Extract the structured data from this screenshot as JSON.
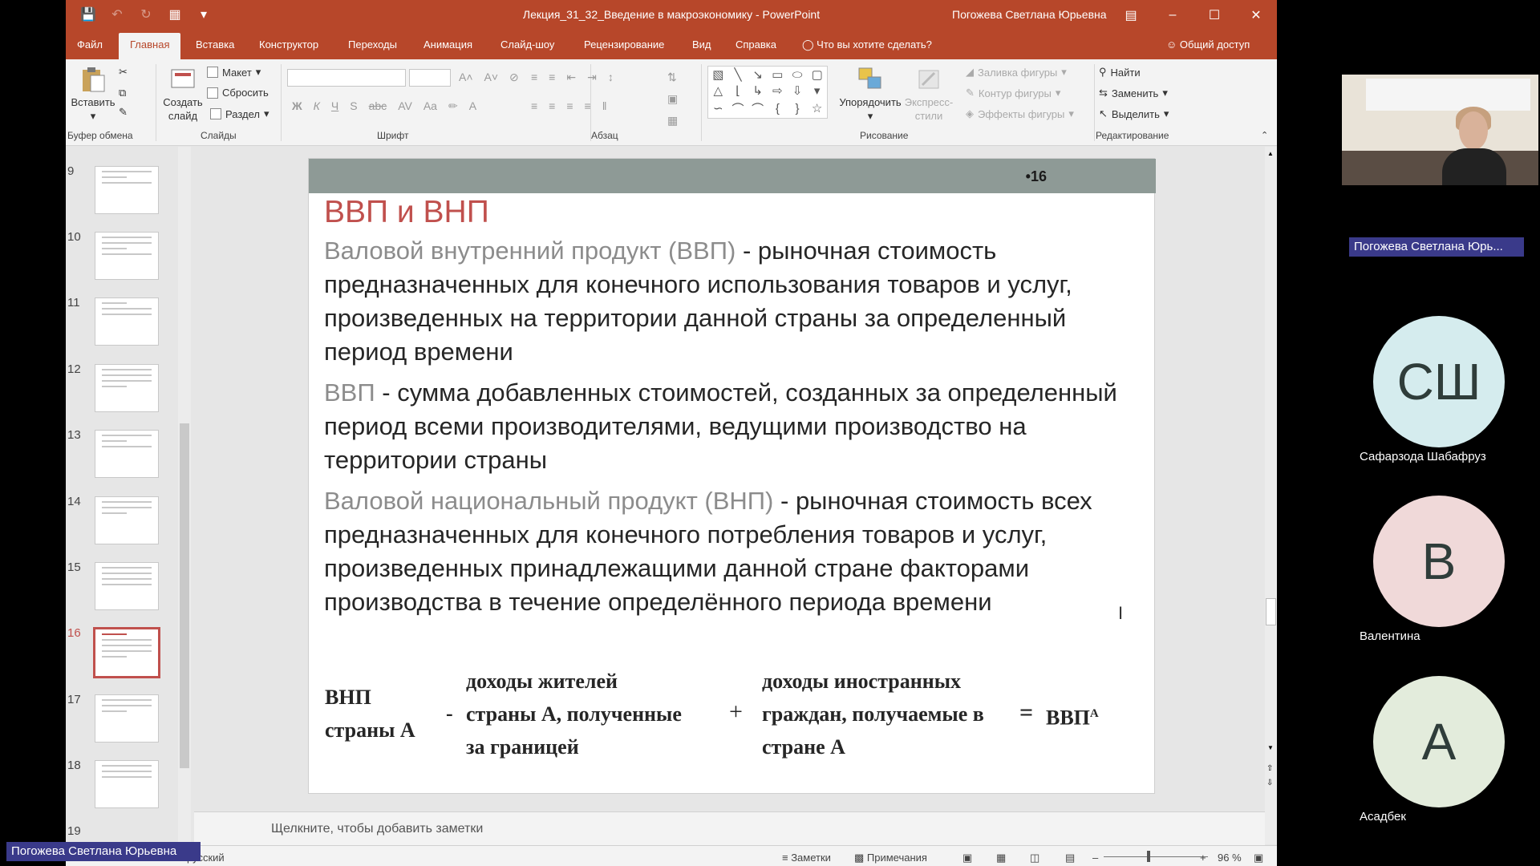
{
  "app": {
    "doc_title": "Лекция_31_32_Введение в макроэкономику  -  PowerPoint",
    "user_name": "Погожева Светлана Юрьевна"
  },
  "tabs": [
    "Файл",
    "Главная",
    "Вставка",
    "Конструктор",
    "Переходы",
    "Анимация",
    "Слайд-шоу",
    "Рецензирование",
    "Вид",
    "Справка"
  ],
  "tell_me": "Что вы хотите сделать?",
  "share": "Общий доступ",
  "ribbon": {
    "paste": "Вставить",
    "new_slide_1": "Создать",
    "new_slide_2": "слайд",
    "layout": "Макет",
    "reset": "Сбросить",
    "section": "Раздел",
    "arrange": "Упорядочить",
    "express_1": "Экспресс-",
    "express_2": "стили",
    "shape_fill": "Заливка фигуры",
    "shape_outline": "Контур фигуры",
    "shape_effects": "Эффекты фигуры",
    "find": "Найти",
    "replace": "Заменить",
    "select": "Выделить",
    "groups": {
      "clipboard": "Буфер обмена",
      "slides": "Слайды",
      "font": "Шрифт",
      "paragraph": "Абзац",
      "drawing": "Рисование",
      "editing": "Редактирование"
    }
  },
  "thumbnails": [
    {
      "num": "9"
    },
    {
      "num": "10"
    },
    {
      "num": "11"
    },
    {
      "num": "12"
    },
    {
      "num": "13"
    },
    {
      "num": "14"
    },
    {
      "num": "15"
    },
    {
      "num": "16"
    },
    {
      "num": "17"
    },
    {
      "num": "18"
    },
    {
      "num": "19"
    }
  ],
  "slide": {
    "number": "•16",
    "title": "ВВП и ВНП",
    "p1_term": "Валовой внутренний продукт (ВВП)",
    "p1_text": " - рыночная стоимость предназначенных для конечного использования товаров и услуг, произведенных на территории данной страны за определенный период времени",
    "p2_term": "ВВП",
    "p2_text": " - сумма добавленных стоимостей, созданных за определенный период всеми производителями, ведущими производство на территории страны",
    "p3_term": "Валовой национальный продукт (ВНП)",
    "p3_text": " - рыночная стоимость всех предназначенных для конечного потребления товаров и услуг, произведенных принадлежащими данной стране факторами производства в течение определённого периода времени",
    "formula": {
      "left_1": "ВНП",
      "left_2": "страны А",
      "minus": "-",
      "mid_1": "доходы жителей",
      "mid_2": "страны А, полученные",
      "mid_3": "за границей",
      "plus": "+",
      "right_1": "доходы иностранных",
      "right_2": "граждан, получаемые в",
      "right_3": "стране А",
      "equals": "=",
      "result": "ВВП",
      "result_sup": "А"
    }
  },
  "notes_placeholder": "Щелкните, чтобы добавить заметки",
  "status": {
    "lang": "русский",
    "notes": "Заметки",
    "comments": "Примечания",
    "zoom": "96 %"
  },
  "participants": {
    "cam_name": "Погожева Светлана Юрь...",
    "list": [
      {
        "initials": "СШ",
        "name": "Сафарзода Шабафруз",
        "color": "#d5ecee"
      },
      {
        "initials": "В",
        "name": "Валентина",
        "color": "#f0d9d9"
      },
      {
        "initials": "А",
        "name": "Асадбек",
        "color": "#e3ecdc"
      }
    ],
    "presenter_tag": "Погожева Светлана Юрьевна"
  }
}
